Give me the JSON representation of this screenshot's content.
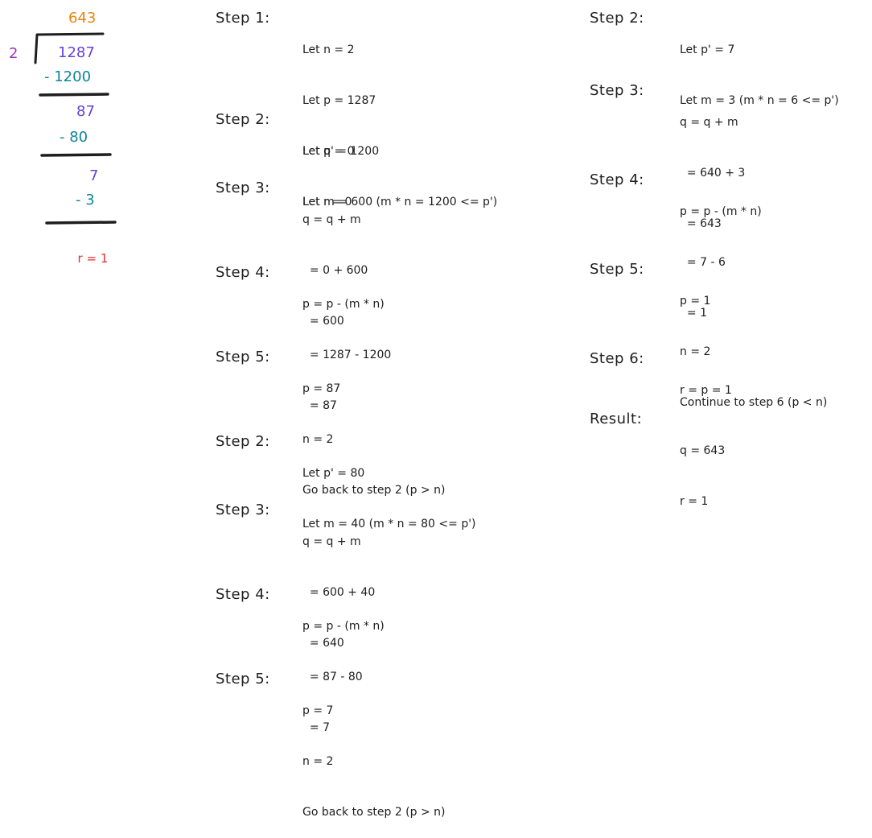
{
  "long_division": {
    "quotient": "643",
    "divisor": "2",
    "dividend": "1287",
    "sub1": "- 1200",
    "rem1": "87",
    "sub2": "- 80",
    "rem2": "7",
    "sub3": "- 3",
    "remainder": "r = 1",
    "colors": {
      "quotient": "#e8850f",
      "divisor": "#9c36b5",
      "dividend": "#6741d9",
      "subtraction": "#0c8599",
      "remainder": "#e03131",
      "ink": "#1e1e1e"
    }
  },
  "steps_left": [
    {
      "label": "Step 1:",
      "lines": [
        "Let n = 2",
        "Let p = 1287",
        "Let q = 0",
        "Let r = 0"
      ]
    },
    {
      "label": "Step 2:",
      "lines": [
        "Let p' = 1200",
        "Let m = 600 (m * n = 1200 <= p')"
      ]
    },
    {
      "label": "Step 3:",
      "lines": [
        "q = q + m",
        "  = 0 + 600",
        "  = 600"
      ]
    },
    {
      "label": "Step 4:",
      "lines": [
        "p = p - (m * n)",
        "  = 1287 - 1200",
        "  = 87"
      ]
    },
    {
      "label": "Step 5:",
      "lines": [
        "p = 87",
        "n = 2",
        "Go back to step 2 (p > n)"
      ]
    },
    {
      "label": "Step 2:",
      "lines": [
        "Let p' = 80",
        "Let m = 40 (m * n = 80 <= p')"
      ]
    },
    {
      "label": "Step 3:",
      "lines": [
        "q = q + m",
        "  = 600 + 40",
        "  = 640"
      ]
    },
    {
      "label": "Step 4:",
      "lines": [
        "p = p - (m * n)",
        "  = 87 - 80",
        "  = 7"
      ]
    },
    {
      "label": "Step 5:",
      "lines": [
        "p = 7",
        "n = 2",
        "Go back to step 2 (p > n)"
      ]
    }
  ],
  "steps_right": [
    {
      "label": "Step 2:",
      "lines": [
        "Let p' = 7",
        "Let m = 3 (m * n = 6 <= p')"
      ]
    },
    {
      "label": "Step 3:",
      "lines": [
        "q = q + m",
        "  = 640 + 3",
        "  = 643"
      ]
    },
    {
      "label": "Step 4:",
      "lines": [
        "p = p - (m * n)",
        "  = 7 - 6",
        "  = 1"
      ]
    },
    {
      "label": "Step 5:",
      "lines": [
        "p = 1",
        "n = 2",
        "Continue to step 6 (p < n)"
      ]
    },
    {
      "label": "Step 6:",
      "lines": [
        "r = p = 1"
      ]
    },
    {
      "label": "Result:",
      "lines": [
        "q = 643",
        "r = 1"
      ]
    }
  ]
}
